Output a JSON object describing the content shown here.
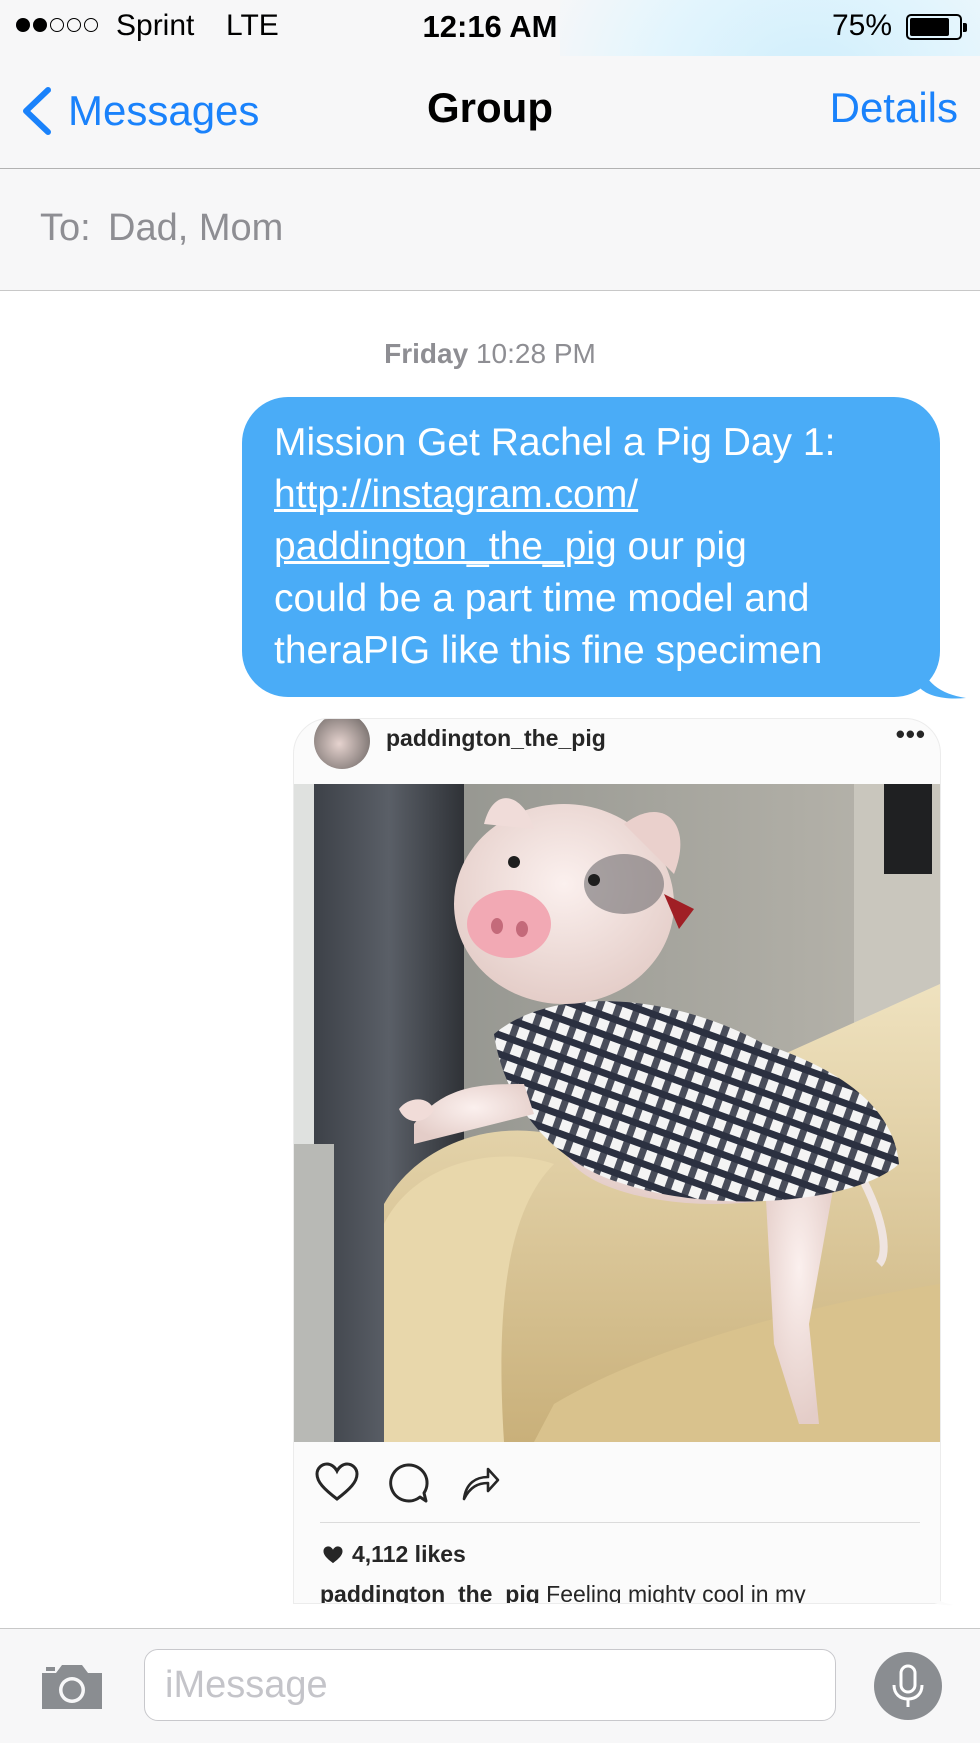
{
  "status_bar": {
    "carrier": "Sprint",
    "network": "LTE",
    "time": "12:16 AM",
    "battery_percent": "75%",
    "battery_level": 0.75,
    "signal_bars": 2,
    "signal_total": 5
  },
  "nav": {
    "back_label": "Messages",
    "title": "Group",
    "details_label": "Details",
    "accent_color": "#1a82fb"
  },
  "recipients": {
    "label": "To:",
    "names": "Dad, Mom"
  },
  "conversation": {
    "timestamp_day": "Friday",
    "timestamp_time": "10:28 PM",
    "message": {
      "line1": "Mission Get Rachel a Pig Day 1:",
      "link_part1": "http://instagram.com/",
      "link_part2": "paddington_the_pig",
      "line3_rest": " our pig",
      "line4": "could be a part time model and",
      "line5": "theraPIG like this fine specimen",
      "bubble_color": "#4aacf7"
    },
    "instagram_preview": {
      "username": "paddington_the_pig",
      "more": "•••",
      "likes": "4,112 likes",
      "caption_user": "paddington_the_pig",
      "caption_text": " Feeling mighty cool in my"
    }
  },
  "compose": {
    "placeholder": "iMessage",
    "value": ""
  }
}
